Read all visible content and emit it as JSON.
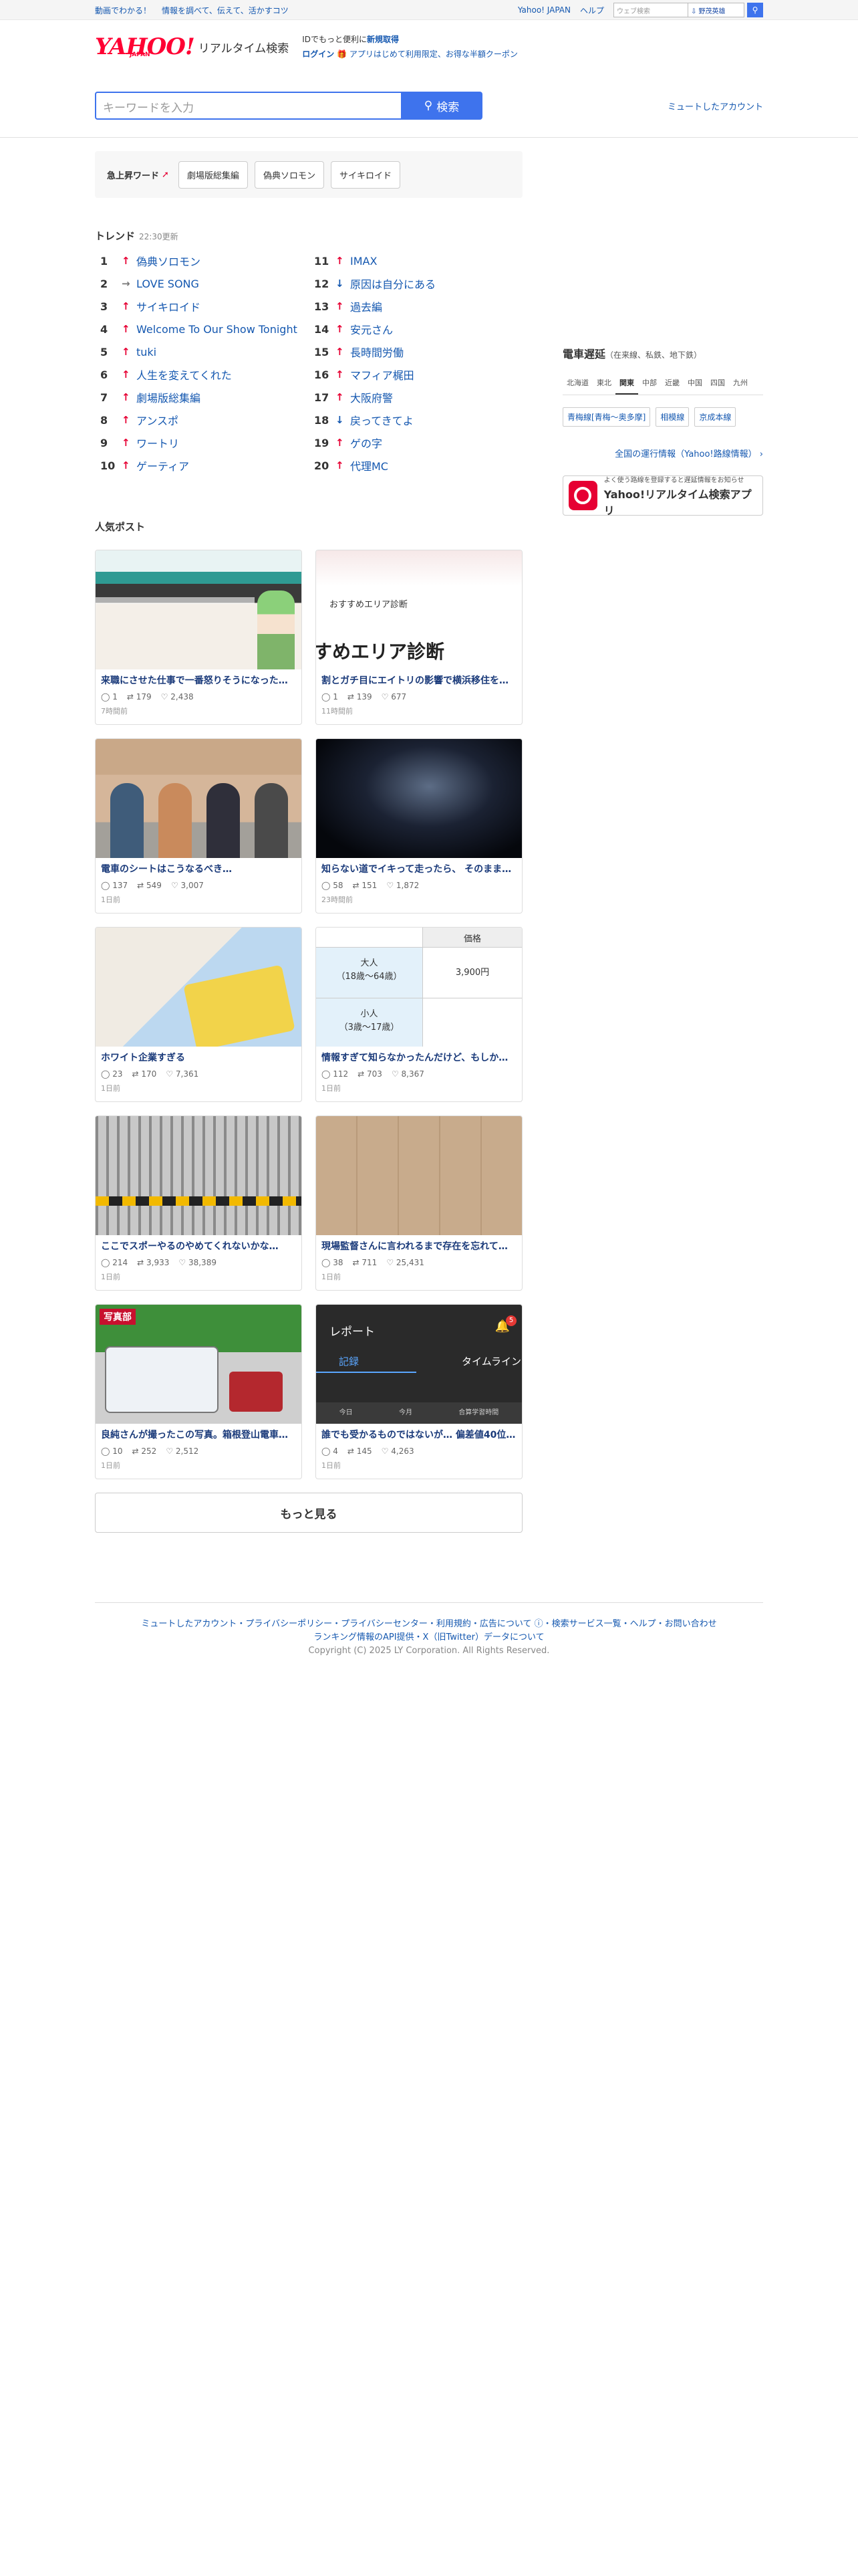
{
  "topbar": {
    "promo1": "動画でわかる！",
    "promo2": "情報を調べて、伝えて、活かすコツ",
    "yahoo_japan": "Yahoo! JAPAN",
    "help": "ヘルプ",
    "mini_placeholder": "ウェブ検索",
    "mini_toggle": "⇩ 野茂英雄"
  },
  "header": {
    "logo": "YAHOO!",
    "logo_japan": "JAPAN",
    "logo_sub": "リアルタイム検索",
    "promo_line1": "IDでもっと便利に",
    "promo_signup": "新規取得",
    "promo_login": "ログイン",
    "promo_line2": "🎁 アプリはじめて利用限定、お得な半額クーポン"
  },
  "search": {
    "placeholder": "キーワードを入力",
    "button": "検索",
    "mute_link": "ミュートしたアカウント"
  },
  "rising": {
    "label": "急上昇ワード",
    "words": [
      "劇場版総集編",
      "偽典ソロモン",
      "サイキロイド"
    ]
  },
  "trends": {
    "title": "トレンド",
    "updated": "22:30更新",
    "items": [
      {
        "rank": "1",
        "dir": "up",
        "text": "偽典ソロモン"
      },
      {
        "rank": "2",
        "dir": "flat",
        "text": "LOVE SONG"
      },
      {
        "rank": "3",
        "dir": "up",
        "text": "サイキロイド"
      },
      {
        "rank": "4",
        "dir": "up",
        "text": "Welcome To Our Show Tonight"
      },
      {
        "rank": "5",
        "dir": "up",
        "text": "tuki"
      },
      {
        "rank": "6",
        "dir": "up",
        "text": "人生を変えてくれた"
      },
      {
        "rank": "7",
        "dir": "up",
        "text": "劇場版総集編"
      },
      {
        "rank": "8",
        "dir": "up",
        "text": "アンスポ"
      },
      {
        "rank": "9",
        "dir": "up",
        "text": "ワートリ"
      },
      {
        "rank": "10",
        "dir": "up",
        "text": "ゲーティア"
      },
      {
        "rank": "11",
        "dir": "up",
        "text": "IMAX"
      },
      {
        "rank": "12",
        "dir": "down",
        "text": "原因は自分にある"
      },
      {
        "rank": "13",
        "dir": "up",
        "text": "過去編"
      },
      {
        "rank": "14",
        "dir": "up",
        "text": "安元さん"
      },
      {
        "rank": "15",
        "dir": "up",
        "text": "長時間労働"
      },
      {
        "rank": "16",
        "dir": "up",
        "text": "マフィア梶田"
      },
      {
        "rank": "17",
        "dir": "up",
        "text": "大阪府警"
      },
      {
        "rank": "18",
        "dir": "down",
        "text": "戻ってきてよ"
      },
      {
        "rank": "19",
        "dir": "up",
        "text": "ゲの字"
      },
      {
        "rank": "20",
        "dir": "up",
        "text": "代理MC"
      }
    ]
  },
  "popular": {
    "title": "人気ポスト",
    "posts": [
      {
        "text": "来職にさせた仕事で一番怒りそうになった…",
        "replies": "1",
        "reposts": "179",
        "likes": "2,438",
        "time": "7時間前",
        "thumb": "gravure"
      },
      {
        "text": "割とガチ目にエイトリの影響で横浜移住を…",
        "replies": "1",
        "reposts": "139",
        "likes": "677",
        "time": "11時間前",
        "thumb": "area",
        "overlay1": "おすすめエリア診断",
        "overlay2": "すめエリア診断"
      },
      {
        "text": "電車のシートはこうなるべき…",
        "replies": "137",
        "reposts": "549",
        "likes": "3,007",
        "time": "1日前",
        "thumb": "train"
      },
      {
        "text": "知らない道でイキって走ったら、 そのまま…",
        "replies": "58",
        "reposts": "151",
        "likes": "1,872",
        "time": "23時間前",
        "thumb": "road"
      },
      {
        "text": "ホワイト企業すぎる",
        "replies": "23",
        "reposts": "170",
        "likes": "7,361",
        "time": "1日前",
        "thumb": "pokemon"
      },
      {
        "text": "情報すぎて知らなかったんだけど、もしか…",
        "replies": "112",
        "reposts": "703",
        "likes": "8,367",
        "time": "1日前",
        "thumb": "table",
        "col_head": "価格",
        "row1_label": "大人",
        "row1_sub": "（18歳～64歳）",
        "row1_price": "3,900円",
        "row2_label": "小人",
        "row2_sub": "（3歳～17歳）"
      },
      {
        "text": "ここでスポーやるのやめてくれないかな…",
        "replies": "214",
        "reposts": "3,933",
        "likes": "38,389",
        "time": "1日前",
        "thumb": "fence"
      },
      {
        "text": "現場監督さんに言われるまで存在を忘れて…",
        "replies": "38",
        "reposts": "711",
        "likes": "25,431",
        "time": "1日前",
        "thumb": "floor"
      },
      {
        "text": "良純さんが撮ったこの写真。箱根登山電車…",
        "replies": "10",
        "reposts": "252",
        "likes": "2,512",
        "time": "1日前",
        "thumb": "bus",
        "badge": "写真部"
      },
      {
        "text": "誰でも受かるものではないが… 偏差値40位…",
        "replies": "4",
        "reposts": "145",
        "likes": "4,263",
        "time": "1日前",
        "thumb": "app",
        "app_title": "レポート",
        "tab1": "記録",
        "tab2": "タイムライン",
        "s1": "今日",
        "s2": "今月",
        "s3": "合算学習時間",
        "bell_count": "5"
      }
    ],
    "more": "もっと見る"
  },
  "rail": {
    "title": "電車遅延",
    "title_sub": "（在来線、私鉄、地下鉄）",
    "regions": [
      "北海道",
      "東北",
      "関東",
      "中部",
      "近畿",
      "中国",
      "四国",
      "九州"
    ],
    "active_region": "関東",
    "lines": [
      "青梅線[青梅～奥多摩]",
      "相模線",
      "京成本線"
    ],
    "all_link": "全国の運行情報（Yahoo!路線情報）",
    "app_small": "よく使う路線を登録すると遅延情報をお知らせ",
    "app_big": "Yahoo!リアルタイム検索アプリ"
  },
  "footer": {
    "links": "ミュートしたアカウント・プライバシーポリシー・プライバシーセンター・利用規約・広告について ⓘ・検索サービス一覧・ヘルプ・お問い合わせ",
    "links2": "ランキング情報のAPI提供・X（旧Twitter）データについて",
    "copyright": "Copyright (C) 2025 LY Corporation. All Rights Reserved."
  }
}
